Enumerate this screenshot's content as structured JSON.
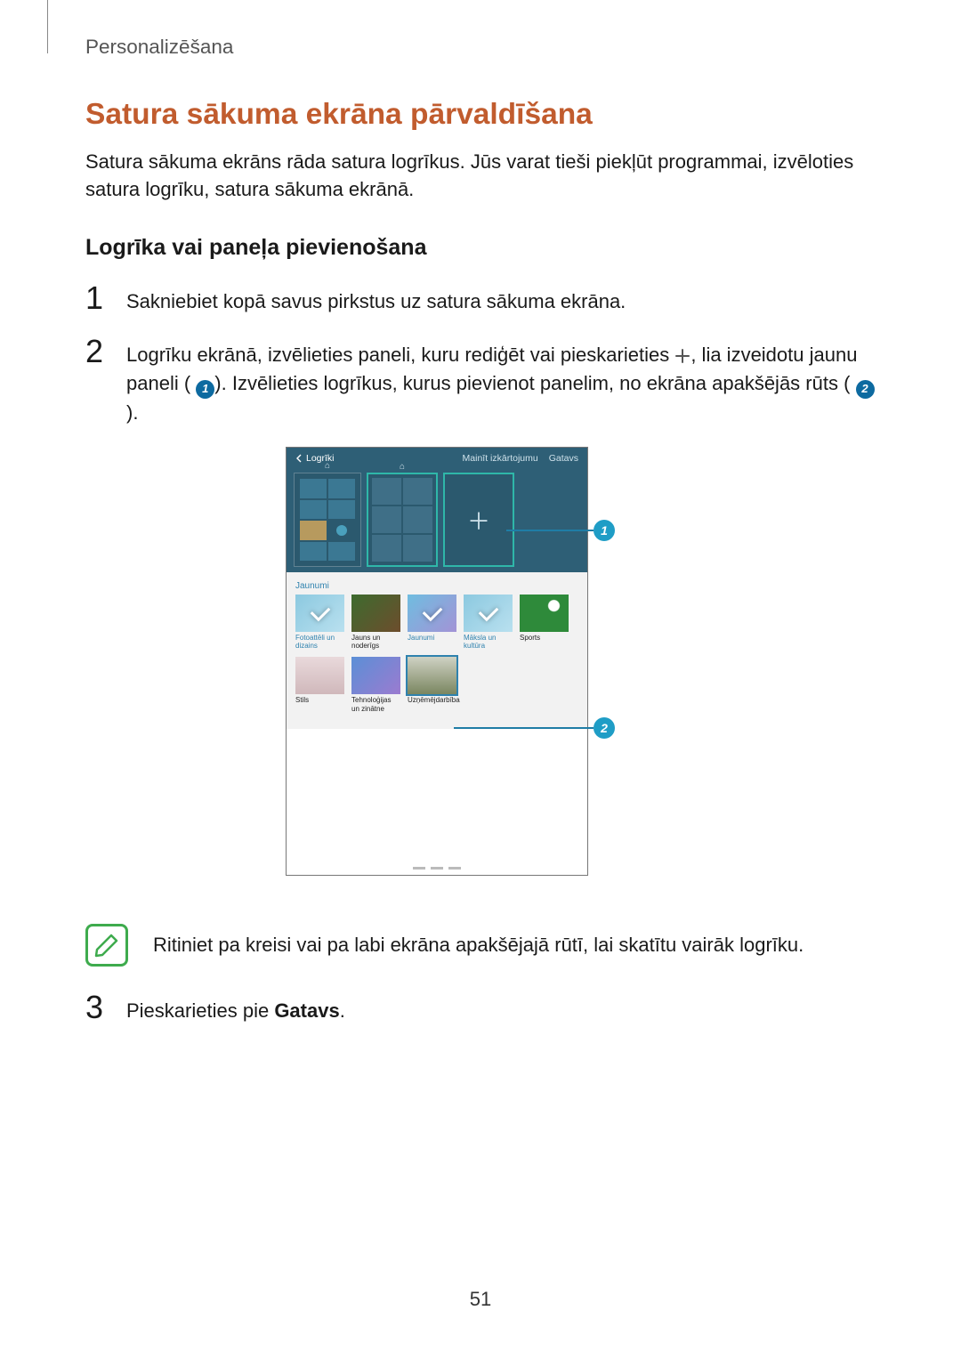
{
  "header": {
    "section": "Personalizēšana"
  },
  "heading": "Satura sākuma ekrāna pārvaldīšana",
  "intro": "Satura sākuma ekrāns rāda satura logrīkus. Jūs varat tieši piekļūt programmai, izvēloties satura logrīku, satura sākuma ekrānā.",
  "subheading": "Logrīka vai paneļa pievienošana",
  "steps": {
    "s1": "Sakniebiet kopā savus pirkstus uz satura sākuma ekrāna.",
    "s2_a": "Logrīku ekrānā, izvēlieties paneli, kuru rediģēt vai pieskarieties ",
    "s2_b": ", lia izveidotu jaunu paneli (",
    "s2_c": "). Izvēlieties logrīkus, kurus pievienot panelim, no ekrāna apakšējās rūts (",
    "s2_d": ").",
    "s3_a": "Pieskarieties pie ",
    "s3_b": "Gatavs",
    "s3_c": "."
  },
  "device": {
    "back": "Logrīki",
    "btn_layout": "Mainīt izkārtojumu",
    "btn_done": "Gatavs",
    "tab": "Jaunumi",
    "row1": [
      "Fotoattēli un dizains",
      "Jauns un noderīgs",
      "Jaunumi",
      "Māksla un kultūra",
      "Sports"
    ],
    "row2": [
      "Stils",
      "Tehnoloģijas un zinātne",
      "Uzņēmējdarbība"
    ]
  },
  "note": "Ritiniet pa kreisi vai pa labi ekrāna apakšējajā rūtī, lai skatītu vairāk logrīku.",
  "callouts": {
    "one": "1",
    "two": "2"
  },
  "pageNumber": "51"
}
